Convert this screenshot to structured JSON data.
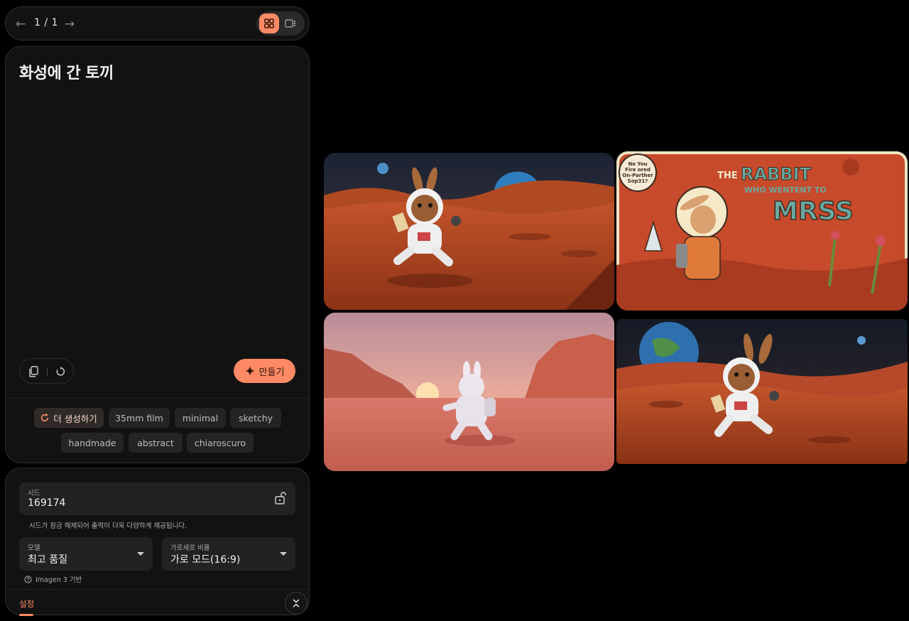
{
  "nav": {
    "counter": "1 / 1",
    "prev_icon": "arrow-left-icon",
    "next_icon": "arrow-right-icon",
    "view_grid_icon": "grid-icon",
    "view_single_icon": "single-view-icon"
  },
  "prompt": {
    "title": "화성에 간 토끼",
    "create_label": "만들기",
    "copy_icon": "copy-icon",
    "reset_icon": "reset-icon"
  },
  "chips": {
    "more_label": "더 생성하기",
    "items": [
      "35mm film",
      "minimal",
      "sketchy",
      "handmade",
      "abstract",
      "chiaroscuro"
    ]
  },
  "settings": {
    "seed_label": "시드",
    "seed_value": "169174",
    "seed_note": "시드가 잠금 해제되어 출력이 더욱 다양하게 제공됩니다.",
    "model_label": "모델",
    "model_value": "최고 품질",
    "model_note": "Imagen 3 기반",
    "ratio_label": "가로세로 비율",
    "ratio_value": "가로 모드(16:9)",
    "tab_label": "설정"
  },
  "gallery": {
    "poster_text": {
      "bubble": [
        "Ne You",
        "Fire ored",
        "On-Parther",
        "Sop31?"
      ],
      "the": "THE",
      "rabbit": "RABBIT",
      "who": "WHO WENTENT TO",
      "mrss": "MRSS"
    }
  },
  "colors": {
    "accent": "#ff8a65",
    "panel_bg": "#121212",
    "field_bg": "#222222",
    "page_bg": "#000000"
  }
}
